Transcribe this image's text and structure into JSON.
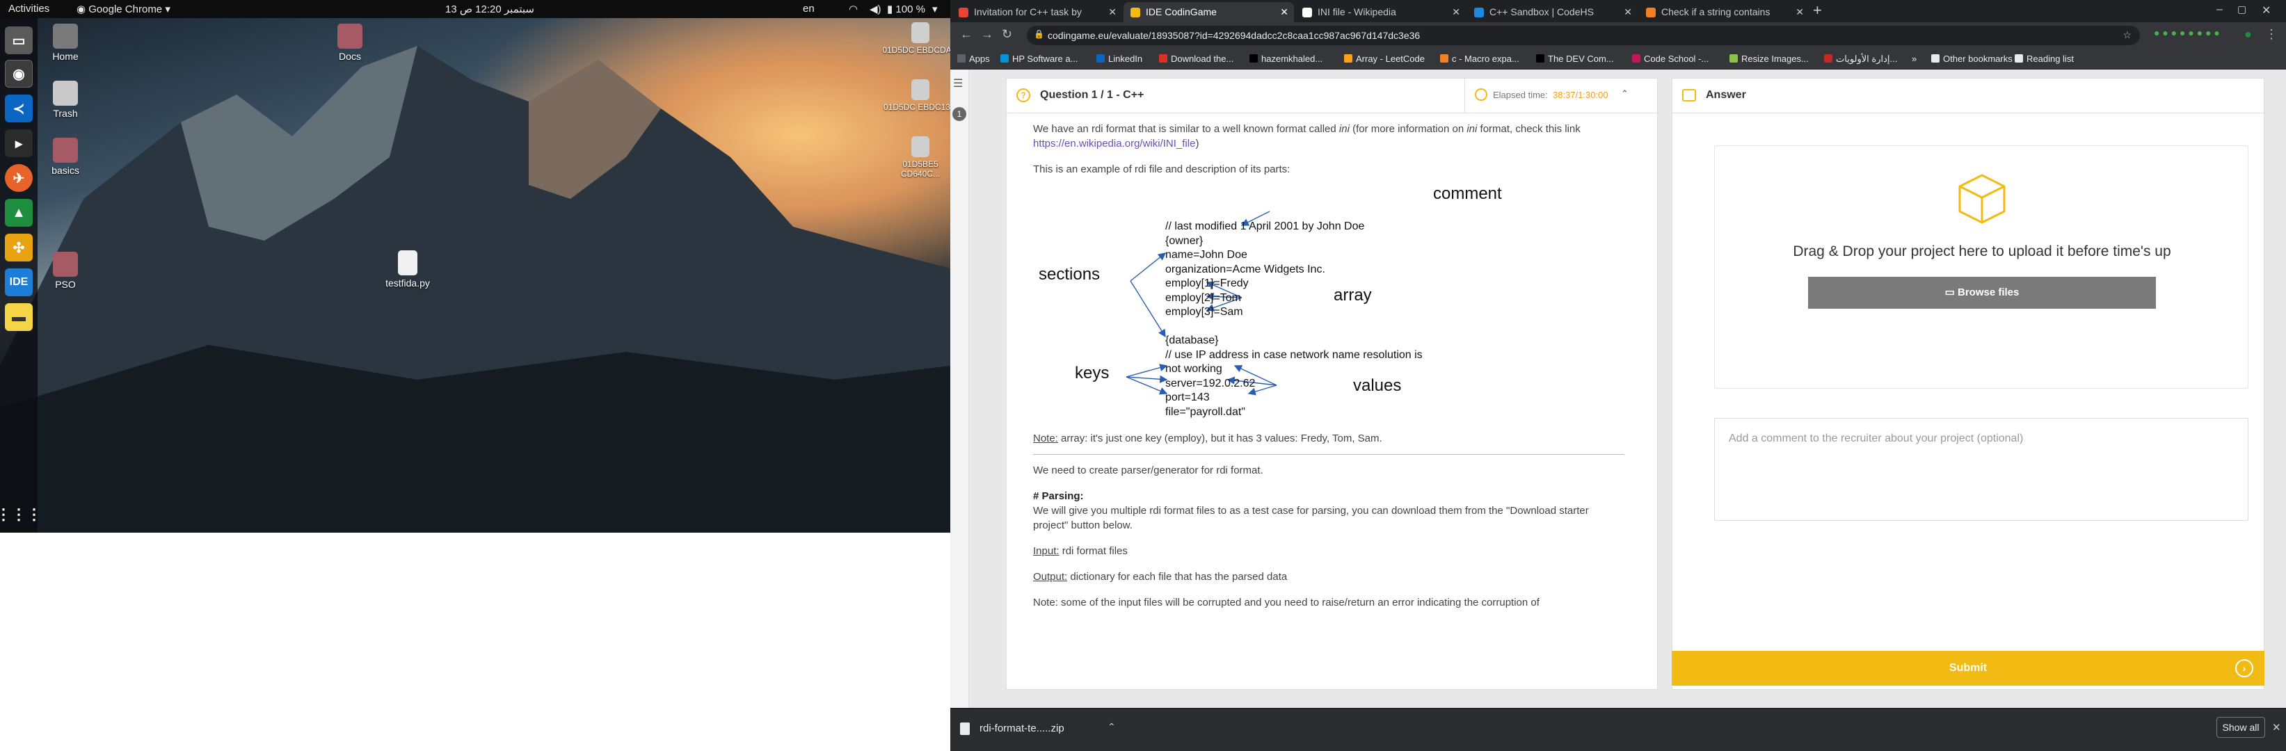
{
  "topbar": {
    "activities": "Activities",
    "app_name": "Google Chrome",
    "clock": "13 سبتمبر 12:20 ص",
    "lang": "en",
    "battery": "100 %"
  },
  "desktop": {
    "items": [
      {
        "label": "Home"
      },
      {
        "label": "Trash"
      },
      {
        "label": "basics"
      },
      {
        "label": "PSO"
      },
      {
        "label": "Docs"
      },
      {
        "label": "testfida.py"
      },
      {
        "label": "01D5DC EBDCDA..."
      },
      {
        "label": "01D5DC EBDC13..."
      },
      {
        "label": "01D5BE5 CD640C..."
      }
    ]
  },
  "chrome": {
    "tabs": [
      {
        "label": "Invitation for C++ task by",
        "fav": "#ea4335"
      },
      {
        "label": "IDE CodinGame",
        "fav": "#f2bb13"
      },
      {
        "label": "INI file - Wikipedia",
        "fav": "#ffffff"
      },
      {
        "label": "C++ Sandbox | CodeHS",
        "fav": "#1e88e5"
      },
      {
        "label": "Check if a string contains",
        "fav": "#f48024"
      }
    ],
    "url": "codingame.eu/evaluate/18935087?id=4292694dadcc2c8caa1cc987ac967d147dc3e36",
    "bookmarks": [
      {
        "label": "Apps",
        "color": "#5f6368"
      },
      {
        "label": "HP Software a...",
        "color": "#0096d6"
      },
      {
        "label": "LinkedIn",
        "color": "#0a66c2"
      },
      {
        "label": "Download the...",
        "color": "#d93025"
      },
      {
        "label": "hazemkhaled...",
        "color": "#000000"
      },
      {
        "label": "Array - LeetCode",
        "color": "#ffa116"
      },
      {
        "label": "c - Macro expa...",
        "color": "#f48024"
      },
      {
        "label": "The DEV Com...",
        "color": "#000000"
      },
      {
        "label": "Code School -...",
        "color": "#c2185b"
      },
      {
        "label": "Resize Images...",
        "color": "#8bc34a"
      },
      {
        "label": "إدارة الأولويات...",
        "color": "#c62828"
      }
    ],
    "other_bookmarks": "Other bookmarks",
    "reading_list": "Reading list"
  },
  "question": {
    "title": "Question 1 / 1 - C++",
    "elapsed_label": "Elapsed time:",
    "elapsed_value": "38:37/1:30:00",
    "number": "1",
    "p1a": "We have an rdi format that is similar to a well known format called",
    "p1b": "ini",
    "p1c": "(for more information on",
    "p1d": "ini",
    "p1e": "format, check this link",
    "link": "https://en.wikipedia.org/wiki/INI_file",
    "p1f": ")",
    "p2": "This is an example of rdi file and description of its parts:",
    "diagram": {
      "comment_label": "comment",
      "sections_label": "sections",
      "array_label": "array",
      "keys_label": "keys",
      "values_label": "values",
      "lines": [
        "// last modified 1 April 2001 by John Doe",
        "{owner}",
        "name=John Doe",
        "organization=Acme Widgets Inc.",
        "employ[1]=Fredy",
        "employ[2]=Tom",
        "employ[3]=Sam",
        "",
        "{database}",
        "// use IP address in case network name resolution is",
        "not working",
        "server=192.0.2.62",
        "port=143",
        "file=\"payroll.dat\""
      ]
    },
    "note_label": "Note:",
    "note_text": "array: it's just one key (employ), but it has 3 values: Fredy, Tom, Sam.",
    "p3": "We need to create parser/generator for rdi format.",
    "parsing_heading": "# Parsing:",
    "p4": "We will give you multiple rdi format files to as a test case for parsing, you can download them from the \"Download starter project\" button below.",
    "input_label": "Input:",
    "input_text": "rdi format files",
    "output_label": "Output:",
    "output_text": "dictionary for each file that has the parsed data",
    "note2_label": "Note:",
    "note2_text": "some of the input files will be corrupted and you need to raise/return an error indicating the corruption of"
  },
  "answer": {
    "title": "Answer",
    "drop_text": "Drag & Drop your project here to upload it before time's up",
    "browse_label": "Browse files",
    "comment_placeholder": "Add a comment to the recruiter about your project (optional)",
    "submit_label": "Submit",
    "accent": "#f2bb13"
  },
  "downloads": {
    "file": "rdi-format-te.....zip",
    "show_all": "Show all"
  }
}
